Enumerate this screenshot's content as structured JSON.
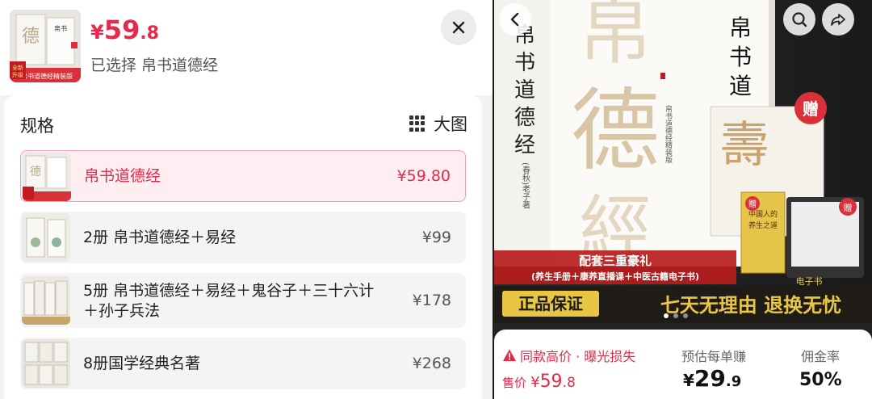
{
  "sheet": {
    "price": {
      "currency": "¥",
      "integer": "59",
      "decimal": ".8"
    },
    "selected_label": "已选择",
    "selected_value": "帛书道德经",
    "spec_title": "规格",
    "big_image_label": "大图",
    "options": [
      {
        "name": "帛书道德经",
        "price": "¥59.80",
        "selected": true
      },
      {
        "name": "2册 帛书道德经＋易经",
        "price": "¥99",
        "selected": false
      },
      {
        "name_line1": "5册 帛书道德经＋易经＋鬼谷子＋三十六计",
        "name_line2": "＋孙子兵法",
        "price": "¥178",
        "selected": false
      },
      {
        "name": "8册国学经典名著",
        "price": "¥268",
        "selected": false
      }
    ],
    "thumb_badge": "全新\n升级",
    "thumb_banner": "帛书道德经精装版"
  },
  "product": {
    "cover_title": "帛书道德经",
    "cover_spine": "帛书道德经",
    "author_mark": "(春秋) 老子 著",
    "gift_badge": "赠",
    "gift_book_title": "中国人的养生之道",
    "gift_ebook": "电子书",
    "promo_title": "配套三重豪礼",
    "promo_sub": "(养生手册＋康养直播课＋中医古籍电子书)",
    "genuine": "正品保证",
    "return_policy": "七天无理由 退换无忧"
  },
  "stats": {
    "warning": "同款高价 · 曝光损失",
    "sale_label": "售价",
    "sale_price": {
      "currency": "¥",
      "integer": "59",
      "decimal": ".8"
    },
    "est_label": "预估每单赚",
    "est_value": {
      "currency": "¥",
      "integer": "29",
      "decimal": ".9"
    },
    "rate_label": "佣金率",
    "rate_value": "50%"
  },
  "colors": {
    "accent": "#e8284a",
    "gold": "#c8a66b"
  }
}
